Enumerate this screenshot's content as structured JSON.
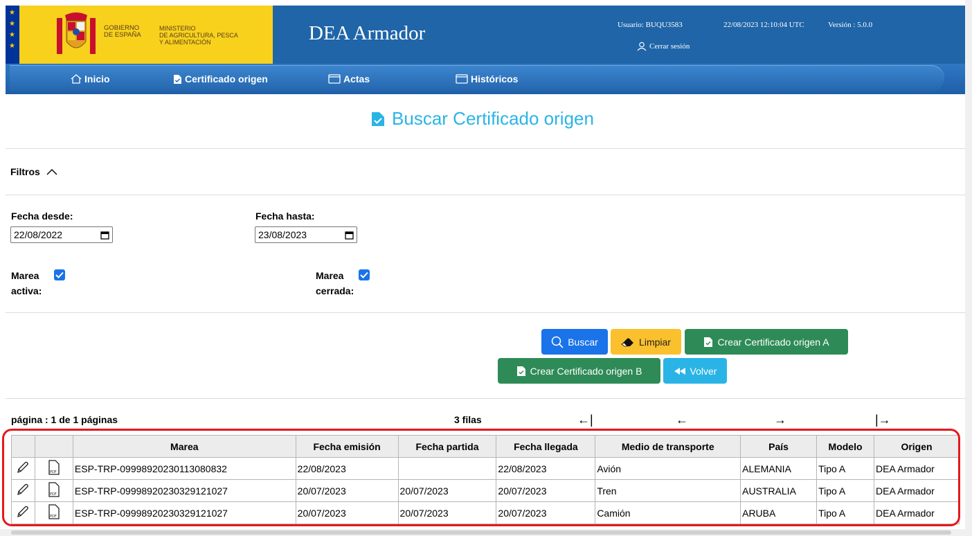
{
  "header": {
    "gov_label": "GOBIERNO\nDE ESPAÑA",
    "ministry_label": "MINISTERIO\nDE AGRICULTURA, PESCA\nY ALIMENTACIÓN",
    "app_title": "DEA Armador",
    "user": "Usuario: BUQU3583",
    "datetime": "22/08/2023 12:10:04 UTC",
    "version": "Versión : 5.0.0",
    "logout_label": "Cerrar sesión",
    "colors": {
      "header_bg": "#1f65a8",
      "gov_strip": "#f7d11c",
      "eu_blue": "#003399"
    }
  },
  "nav": {
    "items": [
      {
        "label": "Inicio",
        "icon": "home-icon"
      },
      {
        "label": "Certificado origen",
        "icon": "document-check-icon"
      },
      {
        "label": "Actas",
        "icon": "calendar-icon"
      },
      {
        "label": "Históricos",
        "icon": "calendar-icon"
      }
    ]
  },
  "page": {
    "heading": "Buscar Certificado origen",
    "heading_color": "#2ab4e6"
  },
  "filters": {
    "toggle_label": "Filtros",
    "fecha_desde_label": "Fecha desde:",
    "fecha_desde_value": "22/08/2022",
    "fecha_hasta_label": "Fecha hasta:",
    "fecha_hasta_value": "23/08/2023",
    "marea_activa_label_1": "Marea",
    "marea_activa_label_2": "activa:",
    "marea_activa_checked": true,
    "marea_cerrada_label_1": "Marea",
    "marea_cerrada_label_2": "cerrada:",
    "marea_cerrada_checked": true
  },
  "actions": {
    "buscar": "Buscar",
    "limpiar": "Limpiar",
    "crear_a": "Crear Certificado origen A",
    "crear_b": "Crear Certificado origen B",
    "volver": "Volver"
  },
  "pagination": {
    "page_info": "página : 1 de 1 páginas",
    "rows_info": "3 filas",
    "first": "←|",
    "prev": "←",
    "next": "→",
    "last": "|→"
  },
  "table": {
    "columns": [
      "",
      "",
      "Marea",
      "Fecha emisión",
      "Fecha partida",
      "Fecha llegada",
      "Medio de transporte",
      "País",
      "Modelo",
      "Origen"
    ],
    "rows": [
      [
        "ESP-TRP-09998920230113080832",
        "22/08/2023",
        "",
        "22/08/2023",
        "Avión",
        "ALEMANIA",
        "Tipo A",
        "DEA Armador"
      ],
      [
        "ESP-TRP-09998920230329121027",
        "20/07/2023",
        "20/07/2023",
        "20/07/2023",
        "Tren",
        "AUSTRALIA",
        "Tipo A",
        "DEA Armador"
      ],
      [
        "ESP-TRP-09998920230329121027",
        "20/07/2023",
        "20/07/2023",
        "20/07/2023",
        "Camión",
        "ARUBA",
        "Tipo A",
        "DEA Armador"
      ]
    ],
    "highlight_color": "#e4181b"
  }
}
